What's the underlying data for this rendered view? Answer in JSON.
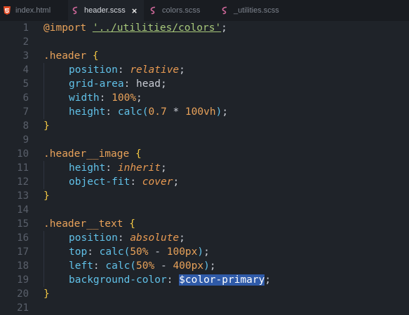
{
  "tabs": [
    {
      "label": "index.html",
      "icon": "html5-icon",
      "active": false
    },
    {
      "label": "header.scss",
      "icon": "sass-icon",
      "active": true,
      "close": "×"
    },
    {
      "label": "colors.scss",
      "icon": "sass-icon",
      "active": false
    },
    {
      "label": "_utilities.scss",
      "icon": "sass-icon",
      "active": false
    }
  ],
  "line_numbers": [
    "1",
    "2",
    "3",
    "4",
    "5",
    "6",
    "7",
    "8",
    "9",
    "10",
    "11",
    "12",
    "13",
    "14",
    "15",
    "16",
    "17",
    "18",
    "19",
    "20",
    "21"
  ],
  "code": {
    "l1": {
      "at": "@import",
      "str": "'../utilities/colors'",
      "end": ";"
    },
    "l3": {
      "sel": ".header",
      "brace": "{"
    },
    "l4": {
      "prop": "position",
      "colon": ":",
      "val": "relative",
      "end": ";"
    },
    "l5": {
      "prop": "grid-area",
      "colon": ":",
      "val": "head",
      "end": ";"
    },
    "l6": {
      "prop": "width",
      "colon": ":",
      "num": "100%",
      "end": ";"
    },
    "l7": {
      "prop": "height",
      "colon": ":",
      "fn": "calc(",
      "a": "0.7",
      "op": " * ",
      "b": "100vh",
      "close": ")",
      "end": ";"
    },
    "l8": {
      "brace": "}"
    },
    "l10": {
      "sel": ".header__image",
      "brace": "{"
    },
    "l11": {
      "prop": "height",
      "colon": ":",
      "val": "inherit",
      "end": ";"
    },
    "l12": {
      "prop": "object-fit",
      "colon": ":",
      "val": "cover",
      "end": ";"
    },
    "l13": {
      "brace": "}"
    },
    "l15": {
      "sel": ".header__text",
      "brace": "{"
    },
    "l16": {
      "prop": "position",
      "colon": ":",
      "val": "absolute",
      "end": ";"
    },
    "l17": {
      "prop": "top",
      "colon": ":",
      "fn": "calc(",
      "a": "50%",
      "op": " - ",
      "b": "100px",
      "close": ")",
      "end": ";"
    },
    "l18": {
      "prop": "left",
      "colon": ":",
      "fn": "calc(",
      "a": "50%",
      "op": " - ",
      "b": "400px",
      "close": ")",
      "end": ";"
    },
    "l19": {
      "prop": "background-color",
      "colon": ":",
      "var": "$color-primary",
      "end": ";"
    },
    "l20": {
      "brace": "}"
    }
  },
  "colors": {
    "background": "#1f2329",
    "tabbar": "#191c21",
    "selection": "#2f5aa8"
  }
}
